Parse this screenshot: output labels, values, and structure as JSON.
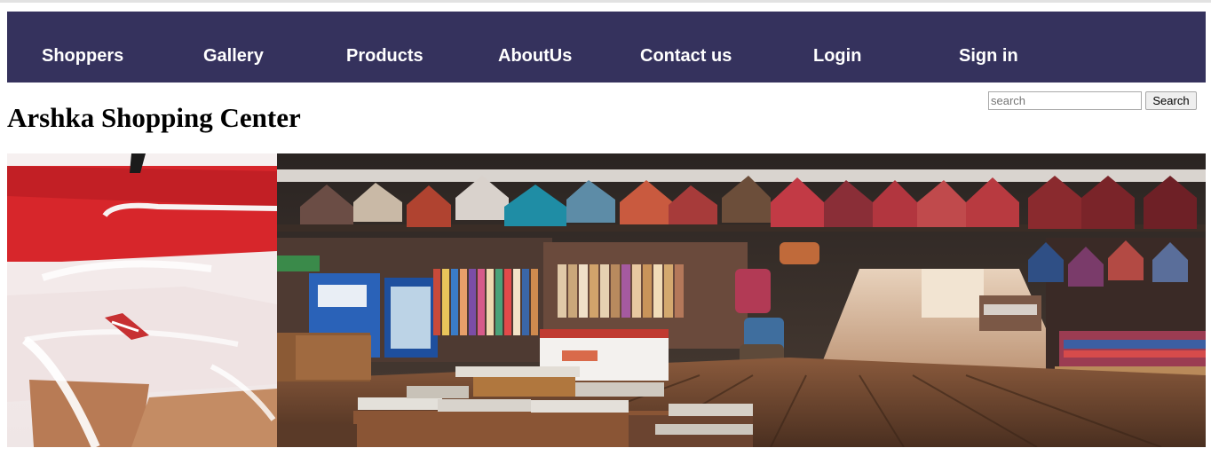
{
  "nav": {
    "items": [
      {
        "label": "Shoppers"
      },
      {
        "label": "Gallery"
      },
      {
        "label": "Products"
      },
      {
        "label": "AboutUs"
      },
      {
        "label": "Contact us"
      },
      {
        "label": "Login"
      },
      {
        "label": "Sign in"
      }
    ]
  },
  "header": {
    "title": "Arshka Shopping Center"
  },
  "search": {
    "placeholder": "search",
    "value": "",
    "button_label": "Search"
  },
  "banner": {
    "left_image": "shopping-bags-photo",
    "right_image": "market-stalls-photo"
  },
  "colors": {
    "nav_background": "#35325d",
    "nav_text": "#ffffff",
    "page_background": "#ffffff"
  }
}
